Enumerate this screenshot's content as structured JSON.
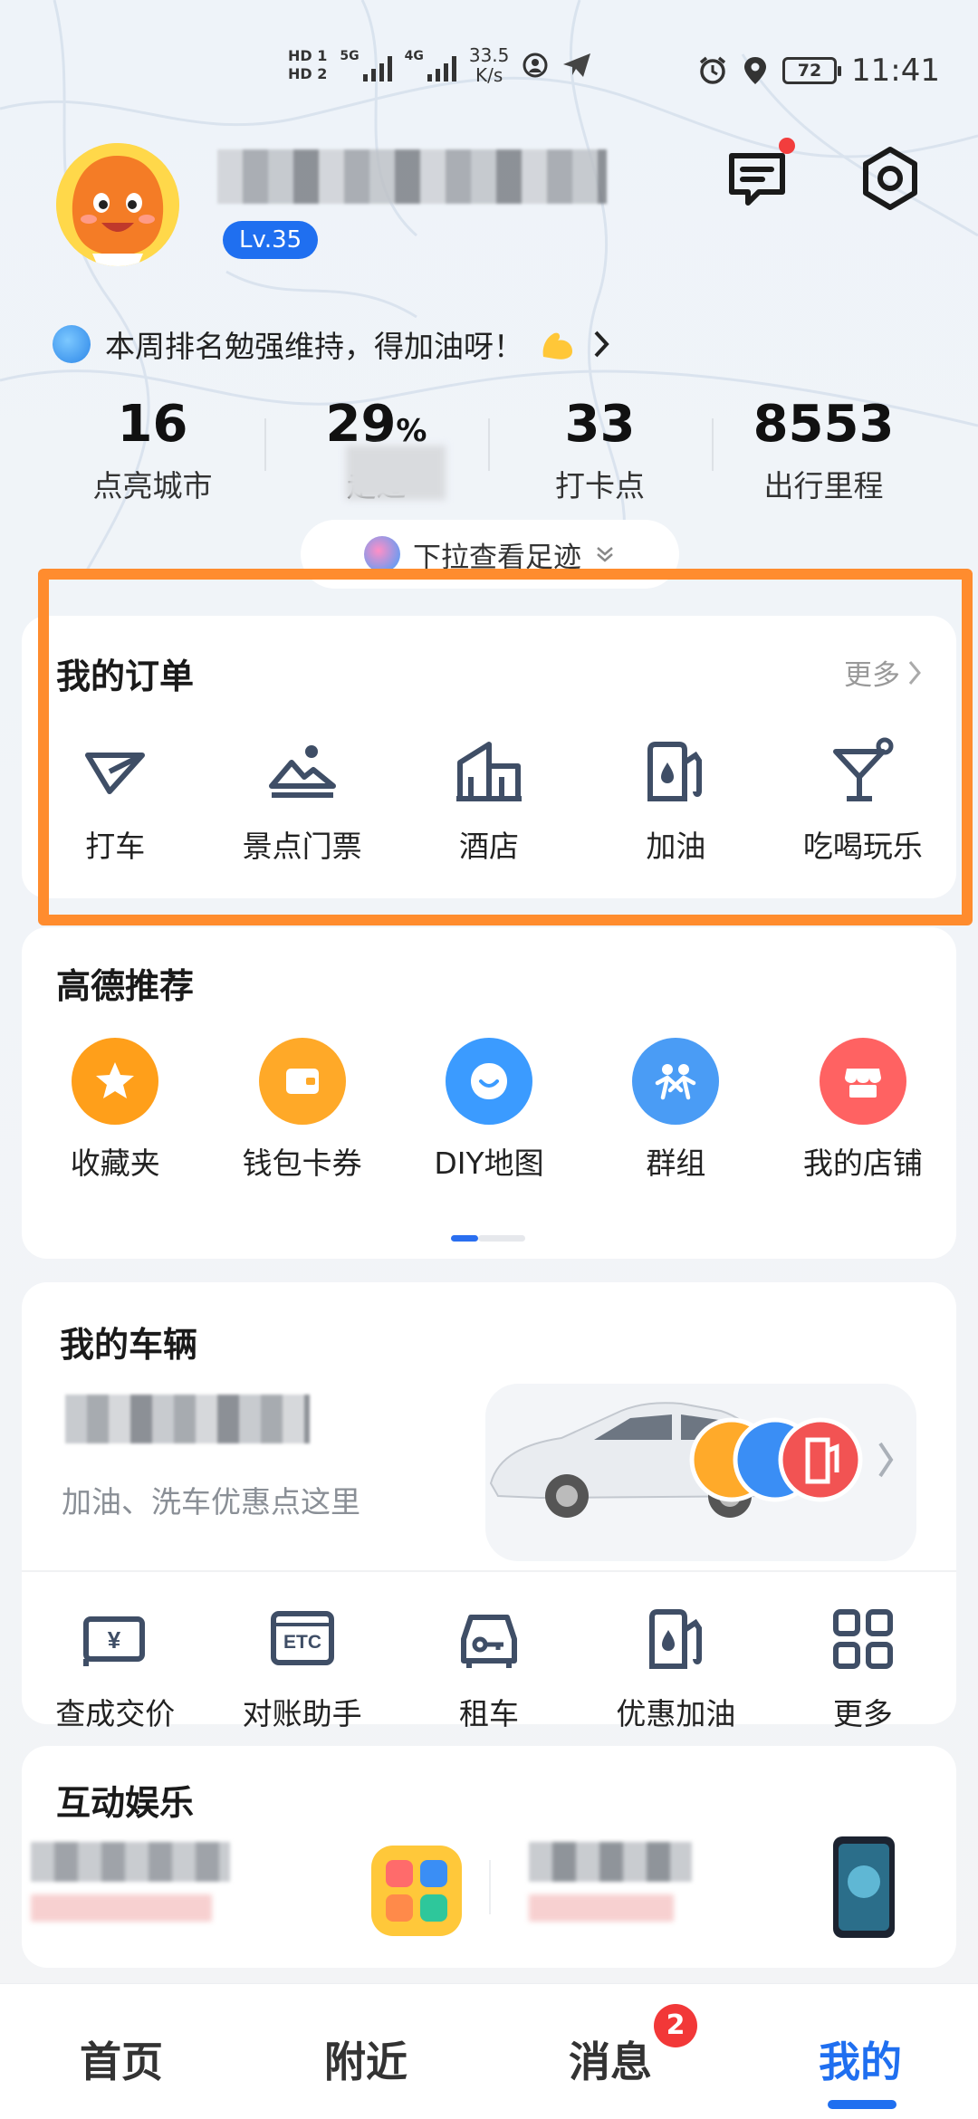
{
  "status_bar": {
    "hd1": "HD 1",
    "hd2": "HD 2",
    "net1": "5G",
    "net2": "4G",
    "speed_value": "33.5",
    "speed_unit": "K/s",
    "battery": "72",
    "time": "11:41"
  },
  "profile": {
    "level": "Lv.35",
    "rank_text": "本周排名勉强维持，得加油呀！",
    "stats": [
      {
        "value": "16",
        "suffix": "",
        "label": "点亮城市"
      },
      {
        "value": "29",
        "suffix": "%",
        "label": "走过"
      },
      {
        "value": "33",
        "suffix": "",
        "label": "打卡点"
      },
      {
        "value": "8553",
        "suffix": "",
        "label": "出行里程"
      }
    ],
    "pull_hint": "下拉查看足迹"
  },
  "orders": {
    "title": "我的订单",
    "more": "更多",
    "items": [
      {
        "label": "打车",
        "icon": "taxi-icon"
      },
      {
        "label": "景点门票",
        "icon": "scenic-ticket-icon"
      },
      {
        "label": "酒店",
        "icon": "hotel-icon"
      },
      {
        "label": "加油",
        "icon": "fuel-icon"
      },
      {
        "label": "吃喝玩乐",
        "icon": "cocktail-icon"
      }
    ]
  },
  "recommend": {
    "title": "高德推荐",
    "items": [
      {
        "label": "收藏夹",
        "icon": "star-icon",
        "color": "#ff9f1a"
      },
      {
        "label": "钱包卡券",
        "icon": "wallet-icon",
        "color": "#ffa928"
      },
      {
        "label": "DIY地图",
        "icon": "smile-map-icon",
        "color": "#3b9bff"
      },
      {
        "label": "群组",
        "icon": "group-icon",
        "color": "#4a9cf5"
      },
      {
        "label": "我的店铺",
        "icon": "shop-icon",
        "color": "#ff6262"
      }
    ]
  },
  "vehicle": {
    "title": "我的车辆",
    "hint": "加油、洗车优惠点这里",
    "tools": [
      {
        "label": "查成交价",
        "icon": "price-tag-icon"
      },
      {
        "label": "对账助手",
        "icon": "etc-icon"
      },
      {
        "label": "租车",
        "icon": "rental-car-icon"
      },
      {
        "label": "优惠加油",
        "icon": "fuel-pump-icon"
      },
      {
        "label": "更多",
        "icon": "grid-more-icon"
      }
    ]
  },
  "entertainment": {
    "title": "互动娱乐"
  },
  "bottom_nav": {
    "items": [
      "首页",
      "附近",
      "消息",
      "我的"
    ],
    "badge": "2"
  },
  "colors": {
    "accent": "#1f6ff0",
    "highlight_border": "#ff8c2e",
    "badge_red": "#f23838"
  }
}
